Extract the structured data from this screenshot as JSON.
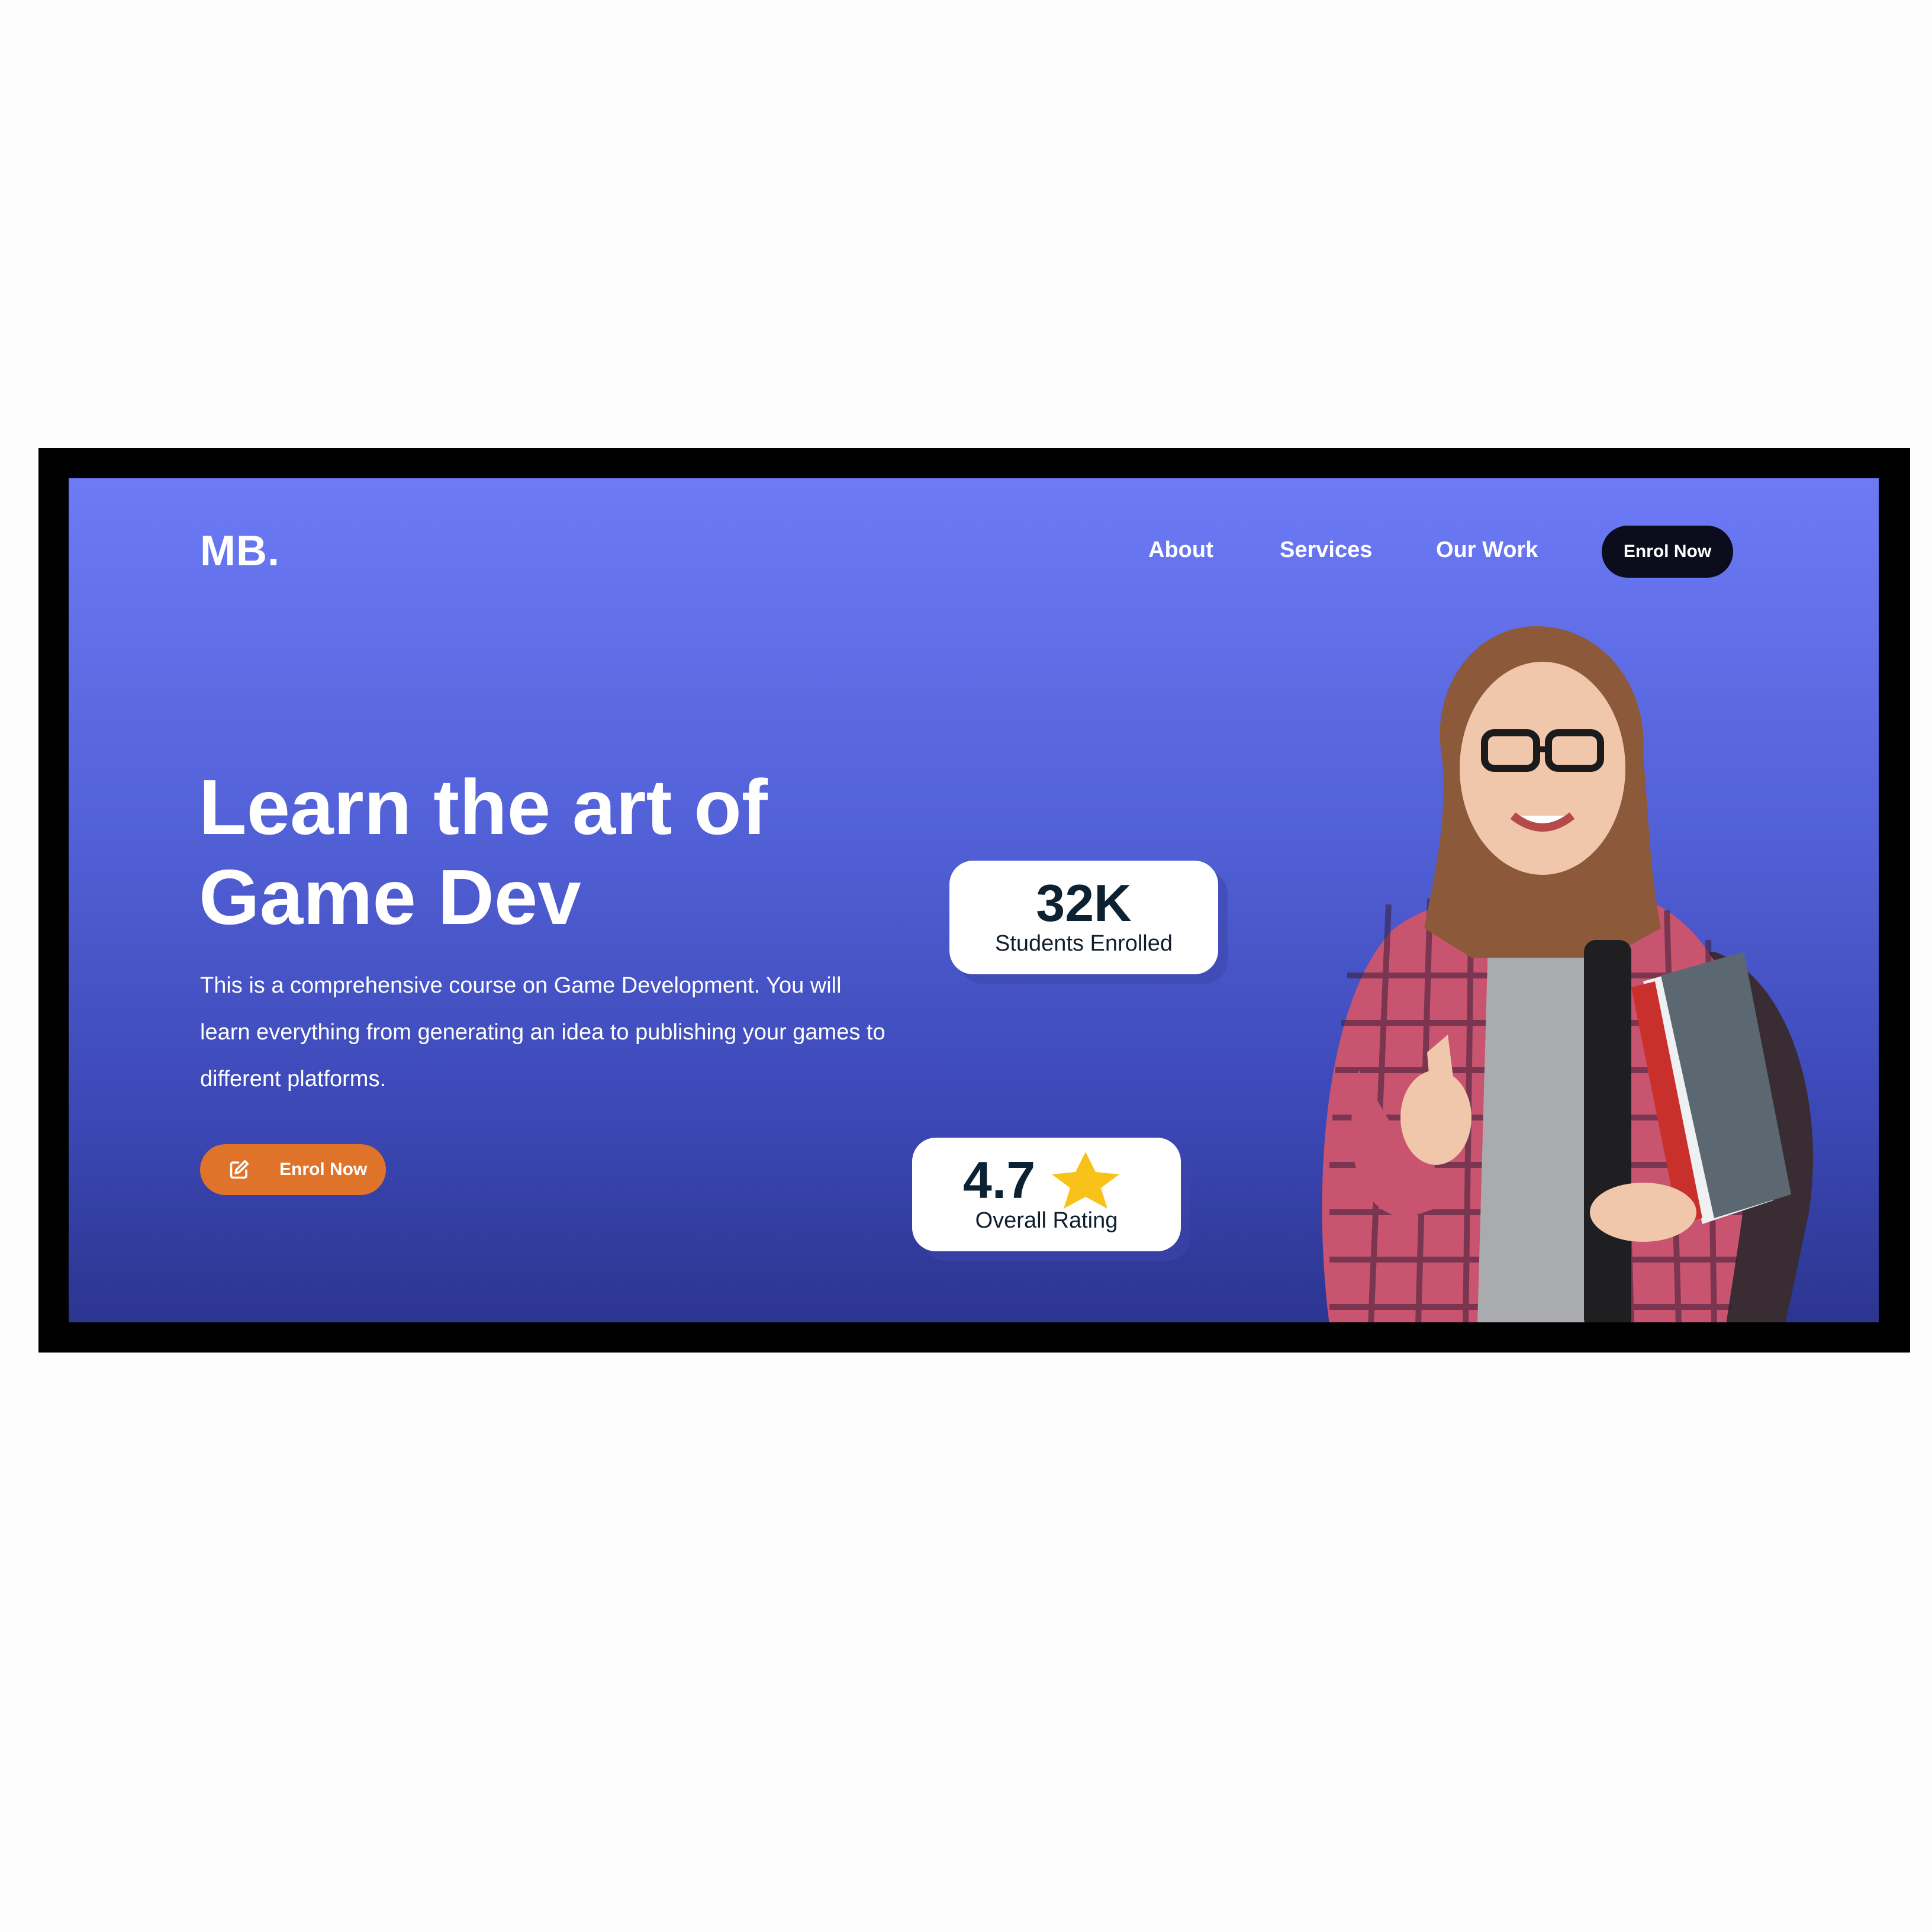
{
  "header": {
    "logo": "MB.",
    "nav": {
      "about": "About",
      "services": "Services",
      "our_work": "Our Work"
    },
    "cta_label": "Enrol Now"
  },
  "hero": {
    "headline_line1": "Learn the art of",
    "headline_line2": "Game Dev",
    "description": "This is a comprehensive course on Game Development. You will learn everything from generating an idea to publishing your games to different platforms.",
    "cta_label": "Enrol Now",
    "cta_icon": "edit-icon"
  },
  "stats": {
    "students": {
      "value": "32K",
      "label": "Students Enrolled"
    },
    "rating": {
      "value": "4.7",
      "label": "Overall Rating",
      "icon": "star-icon"
    }
  },
  "colors": {
    "gradient_top": "#6d7af6",
    "gradient_bottom": "#2c3590",
    "cta_orange": "#e0732a",
    "nav_button": "#0c0d1c",
    "star": "#f9c21b"
  }
}
